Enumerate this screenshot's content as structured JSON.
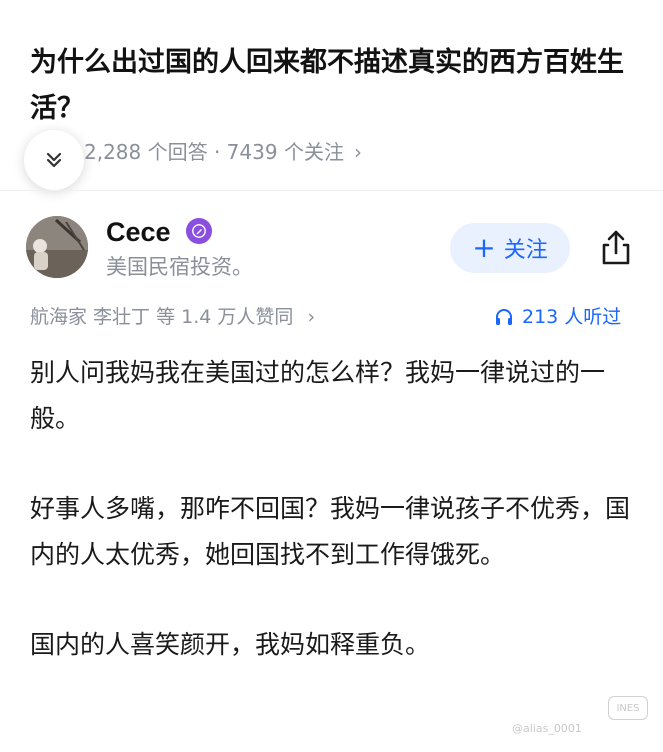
{
  "question": {
    "title": "为什么出过国的人回来都不描述真实的西方百姓生活？",
    "stats_text": "2,288 个回答 · 7439 个关注",
    "stats_chevron": "›"
  },
  "author": {
    "name": "Cece",
    "bio": "美国民宿投资。",
    "badge_icon": "pen-icon"
  },
  "actions": {
    "follow_label": "关注",
    "follow_plus": "+"
  },
  "social": {
    "upvote_text": "航海家 李壮丁 等 1.4 万人赞同",
    "upvote_chevron": "›",
    "listen_text": "213 人听过"
  },
  "answer": {
    "paragraphs": [
      "别人问我妈我在美国过的怎么样？我妈一律说过的一般。",
      "好事人多嘴，那咋不回国？我妈一律说孩子不优秀，国内的人太优秀，她回国找不到工作得饿死。",
      "国内的人喜笑颜开，我妈如释重负。"
    ]
  },
  "watermark": {
    "text": "@alias_0001",
    "logo_text": "INES"
  },
  "colors": {
    "accent": "#1a66ff",
    "muted": "#8a8f99",
    "badge": "#8a4ee0",
    "follow_bg": "#eaf1fe"
  }
}
